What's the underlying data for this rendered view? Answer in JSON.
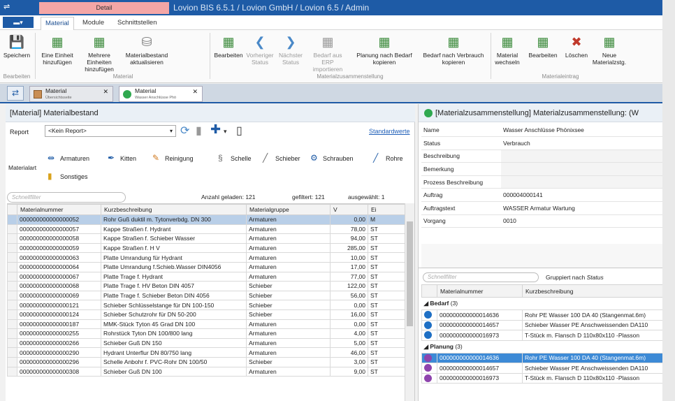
{
  "window": {
    "detail_tab": "Detail",
    "title": "Lovion BIS 6.5.1 / Lovion GmbH / Lovion 6.5 / Admin"
  },
  "menu": {
    "app_button": "",
    "tabs": [
      "Material",
      "Module",
      "Schnittstellen"
    ]
  },
  "ribbon": {
    "buttons": [
      {
        "label": "Speichern",
        "icon": "save-icon",
        "enabled": true
      },
      {
        "label": "Eine Einheit hinzufügen",
        "icon": "add-unit-icon",
        "enabled": true
      },
      {
        "label": "Mehrere Einheiten hinzufügen",
        "icon": "add-units-icon",
        "enabled": true
      },
      {
        "label": "Materialbestand aktualisieren",
        "icon": "refresh-stock-icon",
        "enabled": true
      },
      {
        "label": "Bearbeiten",
        "icon": "edit-icon",
        "enabled": true
      },
      {
        "label": "Vorheriger Status",
        "icon": "prev-status-icon",
        "enabled": false
      },
      {
        "label": "Nächster Status",
        "icon": "next-status-icon",
        "enabled": false
      },
      {
        "label": "Bedarf aus ERP importieren",
        "icon": "erp-import-icon",
        "enabled": false
      },
      {
        "label": "Planung nach Bedarf kopieren",
        "icon": "copy-plan-icon",
        "enabled": true
      },
      {
        "label": "Bedarf nach Verbrauch kopieren",
        "icon": "copy-demand-icon",
        "enabled": true
      },
      {
        "label": "Material wechseln",
        "icon": "switch-material-icon",
        "enabled": true
      },
      {
        "label": "Bearbeiten",
        "icon": "edit-entry-icon",
        "enabled": true
      },
      {
        "label": "Löschen",
        "icon": "delete-icon",
        "enabled": true
      },
      {
        "label": "Neue Materialzstg.",
        "icon": "new-compilation-icon",
        "enabled": true
      }
    ],
    "groups": [
      "Bearbeiten",
      "Material",
      "Materialzusammenstellung",
      "Materialeintrag"
    ]
  },
  "doc_tabs": [
    {
      "label": "Material",
      "sub": "Übersichtsseite"
    },
    {
      "label": "Material",
      "sub": "Wasser Anschlüsse Phö"
    }
  ],
  "left": {
    "header": "[Material] Materialbestand",
    "report_label": "Report",
    "report_value": "<Kein Report>",
    "standardwerte": "Standardwerte",
    "materialart_label": "Materialart",
    "materialarten": [
      "Armaturen",
      "Kitten",
      "Reinigung",
      "Schelle",
      "Schieber",
      "Schrauben",
      "Rohre",
      "Sonstiges"
    ],
    "filter_placeholder": "Schnellfilter",
    "loaded": "Anzahl geladen: 121",
    "filtered": "gefiltert: 121",
    "selected": "ausgewählt: 1",
    "columns": [
      "Materialnummer",
      "Kurzbeschreibung",
      "Materialgruppe",
      "V",
      "Ei"
    ],
    "rows": [
      [
        "000000000000000052",
        "Rohr Guß duktil m. Tytonverbdg. DN 300",
        "Armaturen",
        "0,00",
        "M"
      ],
      [
        "000000000000000057",
        "Kappe Straßen f. Hydrant",
        "Armaturen",
        "78,00",
        "ST"
      ],
      [
        "000000000000000058",
        "Kappe Straßen f. Schieber Wasser",
        "Armaturen",
        "94,00",
        "ST"
      ],
      [
        "000000000000000059",
        "Kappe Straßen f. H V",
        "Armaturen",
        "285,00",
        "ST"
      ],
      [
        "000000000000000063",
        "Platte Umrandung für Hydrant",
        "Armaturen",
        "10,00",
        "ST"
      ],
      [
        "000000000000000064",
        "Platte Umrandung f.Schieb.Wasser DIN4056",
        "Armaturen",
        "17,00",
        "ST"
      ],
      [
        "000000000000000067",
        "Platte Trage f. Hydrant",
        "Armaturen",
        "77,00",
        "ST"
      ],
      [
        "000000000000000068",
        "Platte Trage f. HV Beton DIN 4057",
        "Schieber",
        "122,00",
        "ST"
      ],
      [
        "000000000000000069",
        "Platte Trage f. Schieber Beton DIN 4056",
        "Schieber",
        "56,00",
        "ST"
      ],
      [
        "000000000000000121",
        "Schieber Schlüsselstange für DN 100-150",
        "Schieber",
        "0,00",
        "ST"
      ],
      [
        "000000000000000124",
        "Schieber Schutzrohr für DN 50-200",
        "Schieber",
        "16,00",
        "ST"
      ],
      [
        "000000000000000187",
        "MMK-Stück Tyton 45 Grad DN 100",
        "Armaturen",
        "0,00",
        "ST"
      ],
      [
        "000000000000000255",
        "Rohrstück Tyton DN 100/800 lang",
        "Armaturen",
        "4,00",
        "ST"
      ],
      [
        "000000000000000266",
        "Schieber Guß DN 150",
        "Armaturen",
        "5,00",
        "ST"
      ],
      [
        "000000000000000290",
        "Hydrant Unterflur DN 80/750 lang",
        "Armaturen",
        "46,00",
        "ST"
      ],
      [
        "000000000000000296",
        "Schelle Anbohr f. PVC-Rohr DN 100/50",
        "Schieber",
        "3,00",
        "ST"
      ],
      [
        "000000000000000308",
        "Schieber Guß DN 100",
        "Armaturen",
        "9,00",
        "ST"
      ]
    ]
  },
  "right": {
    "header": "[Materialzusammenstellung] Materialzusammenstellung: (W",
    "props": [
      {
        "k": "Name",
        "v": "Wasser Anschlüsse Phönixsee"
      },
      {
        "k": "Status",
        "v": "Verbrauch"
      },
      {
        "k": "Beschreibung",
        "v": ""
      },
      {
        "k": "Bemerkung",
        "v": ""
      },
      {
        "k": "Prozess Beschreibung",
        "v": ""
      },
      {
        "k": "Auftrag",
        "v": "000004000141"
      },
      {
        "k": "Auftragstext",
        "v": "WASSER Armatur Wartung"
      },
      {
        "k": "Vorgang",
        "v": "0010"
      }
    ],
    "filter_placeholder": "Schnellfilter",
    "gruppiert_prefix": "Gruppiert nach",
    "gruppiert_field": "Status",
    "columns": [
      "Materialnummer",
      "Kurzbeschreibung"
    ],
    "groups": [
      {
        "name": "Bedarf",
        "count": "(3)",
        "color": "#1e6fc4",
        "rows": [
          [
            "000000000000014636",
            "Rohr PE Wasser 100 DA 40 (Stangenmat.6m)"
          ],
          [
            "000000000000014657",
            "Schieber Wasser PE Anschweissenden DA110"
          ],
          [
            "000000000000016973",
            "T-Stück m. Flansch D 110x80x110 -Plasson"
          ]
        ]
      },
      {
        "name": "Planung",
        "count": "(3)",
        "color": "#8e44ad",
        "rows": [
          [
            "000000000000014636",
            "Rohr PE Wasser 100 DA 40 (Stangenmat.6m)"
          ],
          [
            "000000000000014657",
            "Schieber Wasser PE Anschweissenden DA110"
          ],
          [
            "000000000000016973",
            "T-Stück m. Flansch D 110x80x110 -Plasson"
          ]
        ]
      }
    ]
  }
}
